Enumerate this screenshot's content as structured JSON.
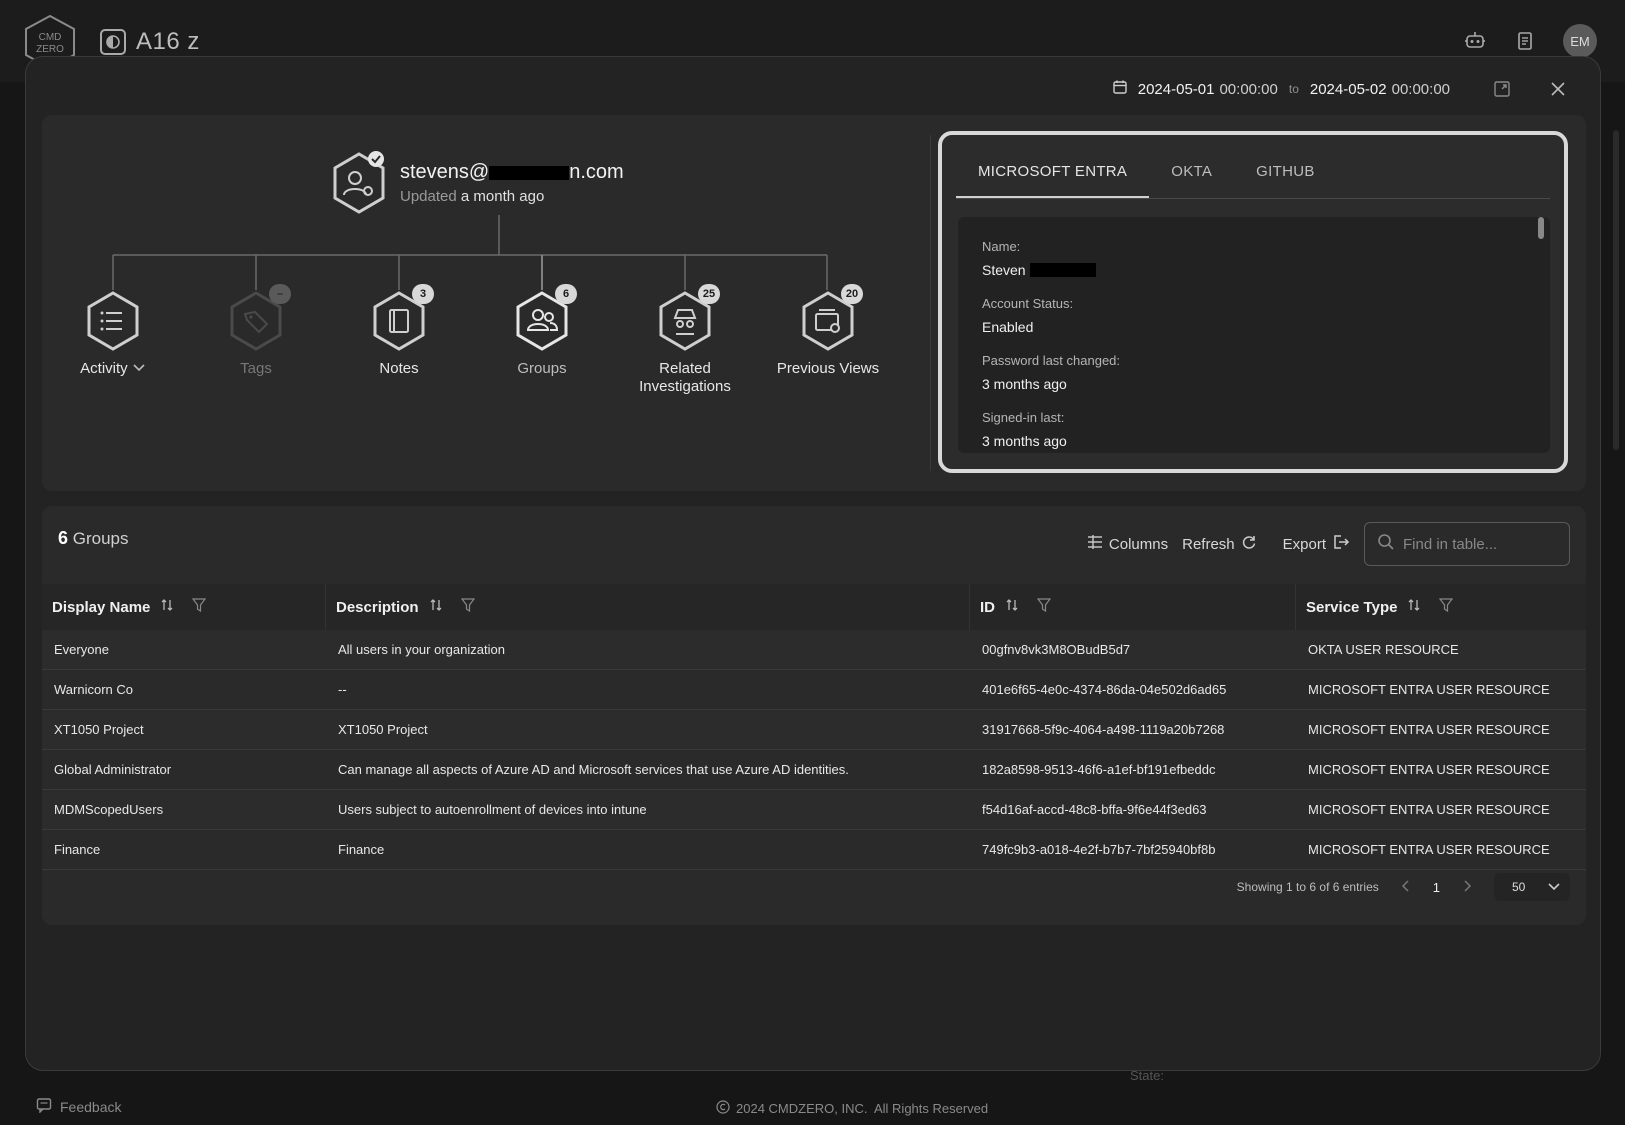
{
  "app": {
    "workspace": "A16 z",
    "avatar_initials": "EM"
  },
  "logo_text": "CMD ZERO",
  "modal": {
    "date_range": {
      "from_date": "2024-05-01",
      "from_time": "00:00:00",
      "to_word": "to",
      "to_date": "2024-05-02",
      "to_time": "00:00:00"
    }
  },
  "user": {
    "email_start": "stevens@",
    "email_end": "n.com",
    "updated_prefix": "Updated",
    "updated_value": "a month ago"
  },
  "nodes": [
    {
      "label": "Activity",
      "badge": "",
      "icon": "list-icon"
    },
    {
      "label": "Tags",
      "badge": "–",
      "icon": "tag-icon"
    },
    {
      "label": "Notes",
      "badge": "3",
      "icon": "notebook-icon"
    },
    {
      "label": "Groups",
      "badge": "6",
      "icon": "users-icon"
    },
    {
      "label": "Related Investigations",
      "badge": "25",
      "icon": "spy-icon"
    },
    {
      "label": "Previous Views",
      "badge": "20",
      "icon": "views-icon"
    }
  ],
  "integrations": {
    "tabs": [
      "MICROSOFT ENTRA",
      "OKTA",
      "GITHUB"
    ],
    "active_tab": "MICROSOFT ENTRA",
    "fields": [
      {
        "label": "Name:",
        "value": "Steven"
      },
      {
        "label": "Account Status:",
        "value": "Enabled"
      },
      {
        "label": "Password last changed:",
        "value": "3 months ago"
      },
      {
        "label": "Signed-in last:",
        "value": "3 months ago"
      }
    ]
  },
  "table": {
    "count": "6",
    "title": "Groups",
    "tools": {
      "columns": "Columns",
      "refresh": "Refresh",
      "export": "Export"
    },
    "search_placeholder": "Find in table...",
    "columns": [
      "Display Name",
      "Description",
      "ID",
      "Service Type"
    ],
    "rows": [
      [
        "Everyone",
        "All users in your organization",
        "00gfnv8vk3M8OBudB5d7",
        "OKTA USER RESOURCE"
      ],
      [
        "Warnicorn Co",
        "--",
        "401e6f65-4e0c-4374-86da-04e502d6ad65",
        "MICROSOFT ENTRA USER RESOURCE"
      ],
      [
        "XT1050 Project",
        "XT1050 Project",
        "31917668-5f9c-4064-a498-1119a20b7268",
        "MICROSOFT ENTRA USER RESOURCE"
      ],
      [
        "Global Administrator",
        "Can manage all aspects of Azure AD and Microsoft services that use Azure AD identities.",
        "182a8598-9513-46f6-a1ef-bf191efbeddc",
        "MICROSOFT ENTRA USER RESOURCE"
      ],
      [
        "MDMScopedUsers",
        "Users subject to autoenrollment of devices into intune",
        "f54d16af-accd-48c8-bffa-9f6e44f3ed63",
        "MICROSOFT ENTRA USER RESOURCE"
      ],
      [
        "Finance",
        "Finance",
        "749fc9b3-a018-4e2f-b7b7-7bf25940bf8b",
        "MICROSOFT ENTRA USER RESOURCE"
      ]
    ],
    "pagination": {
      "summary": "Showing 1 to 6 of 6 entries",
      "page": "1",
      "page_size": "50"
    }
  },
  "footer": {
    "feedback": "Feedback",
    "copyright": "2024 CMDZERO, INC.  All Rights Reserved"
  },
  "background_text": "State:"
}
